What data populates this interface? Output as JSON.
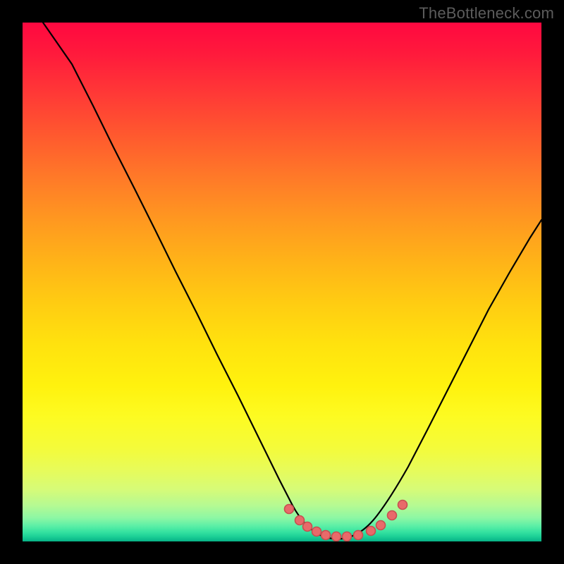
{
  "watermark": {
    "text": "TheBottleneck.com"
  },
  "palette": {
    "page_bg": "#000000",
    "curve_stroke": "#000000",
    "marker_fill": "#e86a6a",
    "marker_stroke": "#c74f50"
  },
  "chart_data": {
    "type": "line",
    "title": "",
    "xlabel": "",
    "ylabel": "",
    "xlim": [
      0,
      100
    ],
    "ylim": [
      0,
      100
    ],
    "grid": false,
    "legend": false,
    "series": [
      {
        "name": "bottleneck-curve",
        "x": [
          4,
          8,
          12,
          16,
          20,
          24,
          28,
          32,
          36,
          40,
          44,
          48,
          50,
          52,
          54,
          56,
          58,
          60,
          62,
          64,
          68,
          72,
          76,
          80,
          84,
          88,
          92,
          96,
          100
        ],
        "y": [
          100,
          92,
          84,
          76,
          68,
          60,
          52,
          44,
          36,
          28,
          20,
          12,
          8,
          5,
          3,
          1.5,
          0.8,
          0.5,
          0.5,
          0.8,
          2,
          4,
          8,
          14,
          21,
          29,
          38,
          47,
          53
        ]
      }
    ],
    "markers": [
      {
        "x": 50.5,
        "y": 5.4
      },
      {
        "x": 52.5,
        "y": 3.3
      },
      {
        "x": 54.0,
        "y": 2.2
      },
      {
        "x": 55.8,
        "y": 1.4
      },
      {
        "x": 57.5,
        "y": 0.9
      },
      {
        "x": 59.5,
        "y": 0.6
      },
      {
        "x": 61.5,
        "y": 0.5
      },
      {
        "x": 63.8,
        "y": 0.7
      },
      {
        "x": 66.2,
        "y": 1.2
      },
      {
        "x": 68.2,
        "y": 2.1
      },
      {
        "x": 70.5,
        "y": 3.6
      },
      {
        "x": 72.3,
        "y": 5.4
      }
    ]
  }
}
